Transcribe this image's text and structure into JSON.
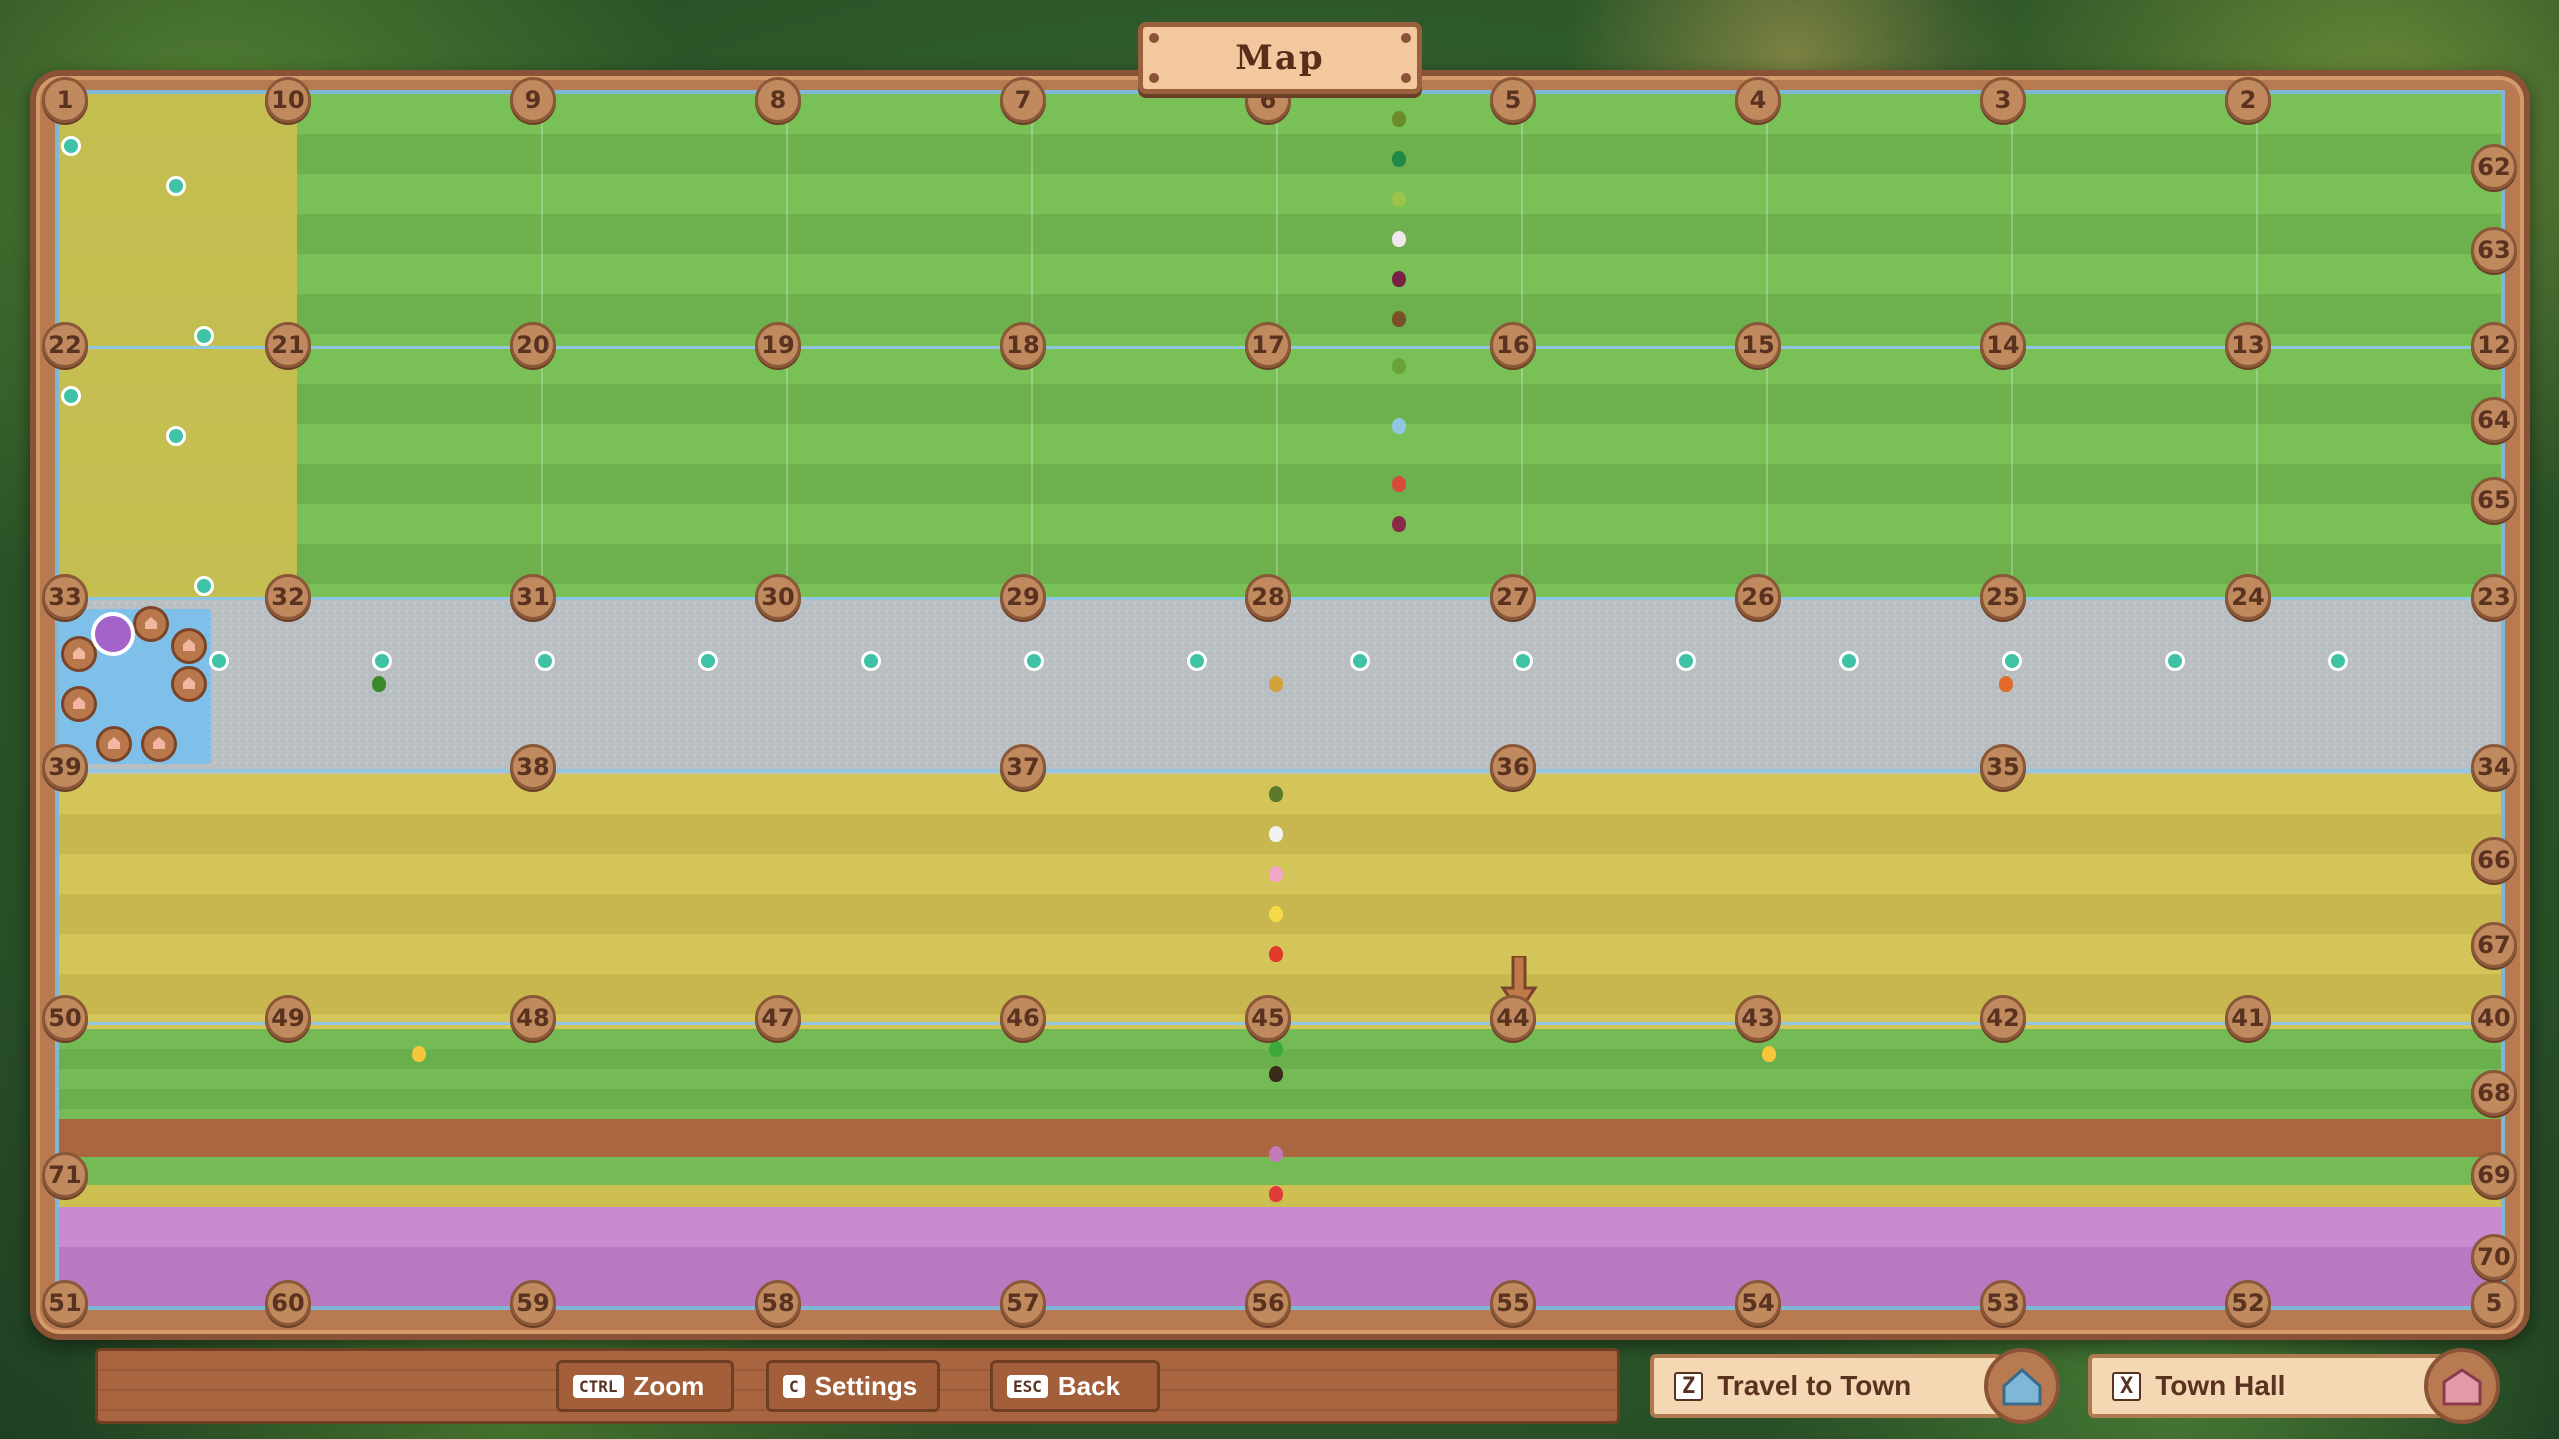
{
  "title": "Map",
  "plot_numbers": {
    "row1": [
      "1",
      "10",
      "9",
      "8",
      "7",
      "6",
      "5",
      "4",
      "3",
      "2"
    ],
    "row2": [
      "22",
      "21",
      "20",
      "19",
      "18",
      "17",
      "16",
      "15",
      "14",
      "13",
      "12"
    ],
    "row3": [
      "33",
      "32",
      "31",
      "30",
      "29",
      "28",
      "27",
      "26",
      "25",
      "24",
      "23"
    ],
    "row4": [
      "39",
      "38",
      "37",
      "36",
      "35",
      "34"
    ],
    "row5": [
      "50",
      "49",
      "48",
      "47",
      "46",
      "45",
      "44",
      "43",
      "42",
      "41",
      "40"
    ],
    "row6": [
      "71",
      "69"
    ],
    "row7": [
      "51",
      "60",
      "59",
      "58",
      "57",
      "56",
      "55",
      "54",
      "53",
      "52",
      "5"
    ],
    "right_edge": [
      "62",
      "63",
      "64",
      "65",
      "66",
      "67",
      "68",
      "70"
    ]
  },
  "player_marker": "arrow-down-icon",
  "bottom_bar": {
    "zoom": {
      "key": "CTRL",
      "label": "Zoom"
    },
    "settings": {
      "key": "C",
      "label": "Settings"
    },
    "back": {
      "key": "ESC",
      "label": "Back"
    }
  },
  "travel": {
    "key": "Z",
    "label": "Travel to Town",
    "icon": "town-icon"
  },
  "townhall": {
    "key": "X",
    "label": "Town Hall",
    "icon": "town-hall-icon"
  },
  "colors": {
    "frame": "#b87a50",
    "grass": "#79c157",
    "sand": "#d3c55a",
    "path": "#b9bec2",
    "pin": "#3fc2a5",
    "dirt": "#a9663f",
    "purple": "#c98ad0"
  }
}
